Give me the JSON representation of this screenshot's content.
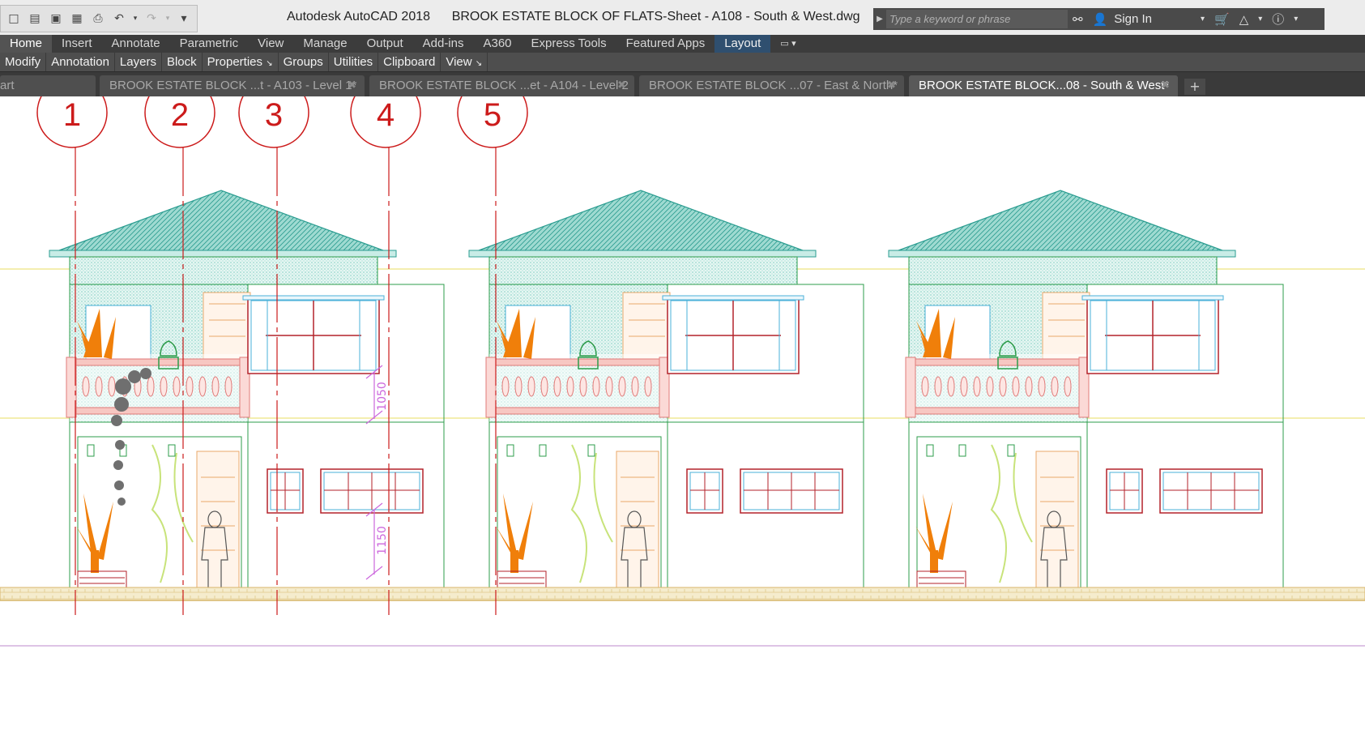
{
  "title_bar": {
    "app_name": "Autodesk AutoCAD 2018",
    "file_name": "BROOK ESTATE BLOCK OF FLATS-Sheet - A108 - South & West.dwg",
    "search_placeholder": "Type a keyword or phrase",
    "sign_in": "Sign In"
  },
  "quick_access": [
    {
      "icon": "new-icon",
      "glyph": "□"
    },
    {
      "icon": "open-icon",
      "glyph": "▤"
    },
    {
      "icon": "save-icon",
      "glyph": "▣"
    },
    {
      "icon": "save-as-icon",
      "glyph": "▦"
    },
    {
      "icon": "plot-icon",
      "glyph": "⎙"
    },
    {
      "icon": "undo-icon",
      "glyph": "↶"
    },
    {
      "icon": "redo-icon",
      "glyph": "↷"
    },
    {
      "icon": "customize-icon",
      "glyph": "▾"
    }
  ],
  "ribbon_tabs": [
    "Home",
    "Insert",
    "Annotate",
    "Parametric",
    "View",
    "Manage",
    "Output",
    "Add-ins",
    "A360",
    "Express Tools",
    "Featured Apps",
    "Layout"
  ],
  "ribbon_active": "Home",
  "ribbon_panels": [
    "Modify",
    "Annotation",
    "Layers",
    "Block",
    "Properties",
    "Groups",
    "Utilities",
    "Clipboard",
    "View"
  ],
  "doc_tabs": [
    {
      "label": "art",
      "active": false
    },
    {
      "label": "BROOK ESTATE BLOCK ...t - A103 - Level 1*",
      "active": false
    },
    {
      "label": "BROOK ESTATE BLOCK ...et - A104 - Level 2",
      "active": false
    },
    {
      "label": "BROOK ESTATE BLOCK ...07 - East & North*",
      "active": false
    },
    {
      "label": "BROOK ESTATE BLOCK...08 - South & West*",
      "active": true
    }
  ],
  "drawing": {
    "grid_labels": [
      "1",
      "2",
      "3",
      "4",
      "5"
    ],
    "dimension_labels": [
      "1050",
      "1150"
    ]
  },
  "colors": {
    "grid_bubble": "#cc1b1b",
    "roof": "#38b3a6",
    "wall_line": "#2e9c4b",
    "balustrade": "#e07a78",
    "window": "#4ab0d8",
    "mullion": "#b3222a",
    "plant": "#f07f0a",
    "door": "#e9a86a",
    "dimension": "#cc66dd",
    "ground": "#e8d9a5"
  }
}
